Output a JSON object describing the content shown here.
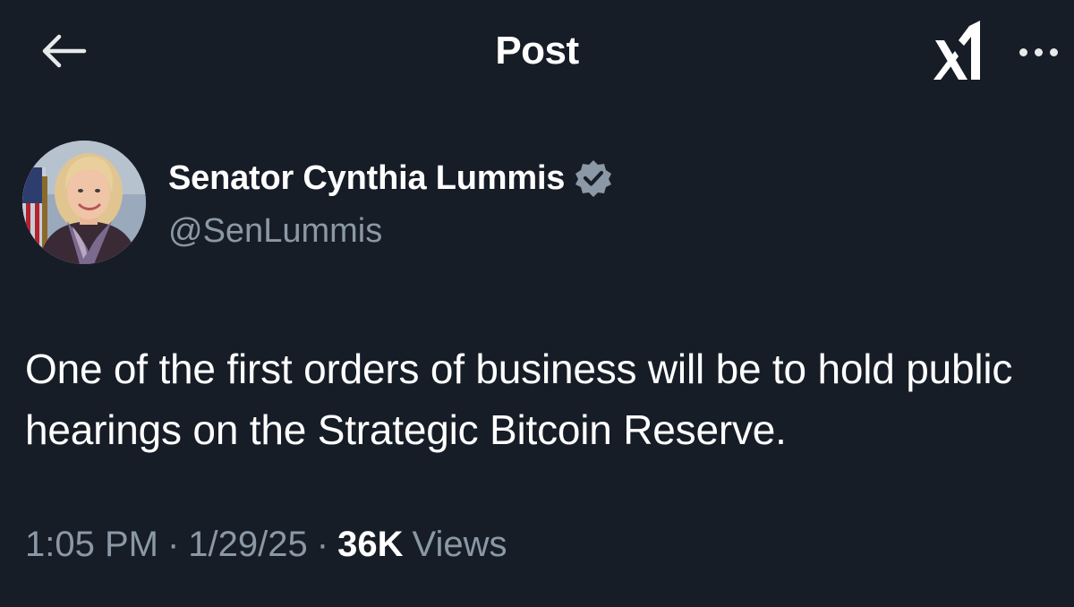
{
  "header": {
    "title": "Post"
  },
  "author": {
    "display_name": "Senator Cynthia Lummis",
    "handle": "@SenLummis",
    "verified_color": "#8b98a5"
  },
  "tweet": {
    "text": "One of the first orders of business will be to hold public hearings on the Strategic Bitcoin Reserve."
  },
  "meta": {
    "time": "1:05 PM",
    "separator": "·",
    "date": "1/29/25",
    "views_count": "36K",
    "views_label": "Views"
  },
  "icons": {
    "back": "arrow-left-icon",
    "grok": "grok-icon",
    "more": "more-horizontal-icon",
    "verified": "verified-badge-icon"
  },
  "colors": {
    "background": "#171d27",
    "text_primary": "#ffffff",
    "text_secondary": "#8b98a5"
  }
}
